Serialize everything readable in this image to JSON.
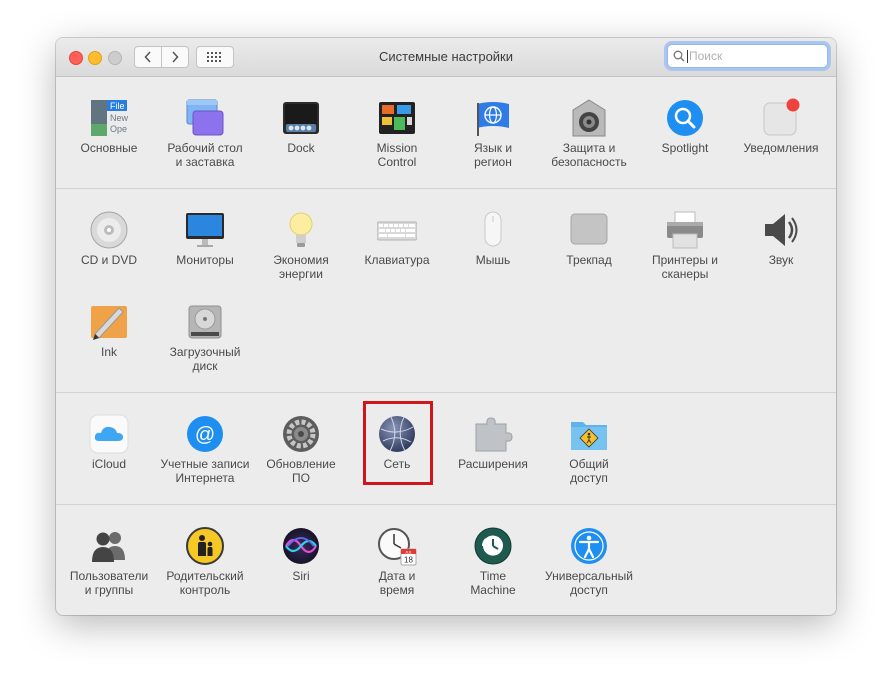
{
  "window": {
    "title": "Системные настройки",
    "search": {
      "placeholder": "Поиск",
      "value": ""
    }
  },
  "rows": [
    [
      {
        "id": "general",
        "label": "Основные",
        "icon": "general-icon"
      },
      {
        "id": "desktop",
        "label": "Рабочий стол\nи заставка",
        "icon": "desktop-screensaver-icon"
      },
      {
        "id": "dock",
        "label": "Dock",
        "icon": "dock-icon"
      },
      {
        "id": "mission",
        "label": "Mission\nControl",
        "icon": "mission-control-icon"
      },
      {
        "id": "language",
        "label": "Язык и\nрегион",
        "icon": "language-region-icon"
      },
      {
        "id": "security",
        "label": "Защита и\nбезопасность",
        "icon": "security-icon"
      },
      {
        "id": "spotlight",
        "label": "Spotlight",
        "icon": "spotlight-icon"
      },
      {
        "id": "notifications",
        "label": "Уведомления",
        "icon": "notifications-icon"
      }
    ],
    [
      {
        "id": "cddvd",
        "label": "CD и DVD",
        "icon": "cd-dvd-icon"
      },
      {
        "id": "displays",
        "label": "Мониторы",
        "icon": "displays-icon"
      },
      {
        "id": "energy",
        "label": "Экономия\nэнергии",
        "icon": "energy-saver-icon"
      },
      {
        "id": "keyboard",
        "label": "Клавиатура",
        "icon": "keyboard-icon"
      },
      {
        "id": "mouse",
        "label": "Мышь",
        "icon": "mouse-icon"
      },
      {
        "id": "trackpad",
        "label": "Трекпад",
        "icon": "trackpad-icon"
      },
      {
        "id": "printers",
        "label": "Принтеры и\nсканеры",
        "icon": "printer-icon"
      },
      {
        "id": "sound",
        "label": "Звук",
        "icon": "sound-icon"
      },
      {
        "id": "ink",
        "label": "Ink",
        "icon": "ink-icon"
      },
      {
        "id": "startup",
        "label": "Загрузочный\nдиск",
        "icon": "startup-disk-icon"
      }
    ],
    [
      {
        "id": "icloud",
        "label": "iCloud",
        "icon": "icloud-icon"
      },
      {
        "id": "internet",
        "label": "Учетные записи\nИнтернета",
        "icon": "internet-accounts-icon"
      },
      {
        "id": "update",
        "label": "Обновление\nПО",
        "icon": "software-update-icon"
      },
      {
        "id": "network",
        "label": "Сеть",
        "icon": "network-icon"
      },
      {
        "id": "extensions",
        "label": "Расширения",
        "icon": "extensions-icon"
      },
      {
        "id": "sharing",
        "label": "Общий\nдоступ",
        "icon": "sharing-icon"
      }
    ],
    [
      {
        "id": "users",
        "label": "Пользователи\nи группы",
        "icon": "users-groups-icon"
      },
      {
        "id": "parental",
        "label": "Родительский\nконтроль",
        "icon": "parental-controls-icon"
      },
      {
        "id": "siri",
        "label": "Siri",
        "icon": "siri-icon"
      },
      {
        "id": "datetime",
        "label": "Дата и\nвремя",
        "icon": "date-time-icon"
      },
      {
        "id": "timemachine",
        "label": "Time\nMachine",
        "icon": "time-machine-icon"
      },
      {
        "id": "accessibility",
        "label": "Универсальный\nдоступ",
        "icon": "accessibility-icon"
      }
    ]
  ],
  "icon_text": {
    "general": [
      "File",
      "New",
      "Ope"
    ],
    "calendar_month": "JUL",
    "calendar_day": "18"
  },
  "colors": {
    "highlight": "#d0161d",
    "accent": "#1e7fe0"
  }
}
